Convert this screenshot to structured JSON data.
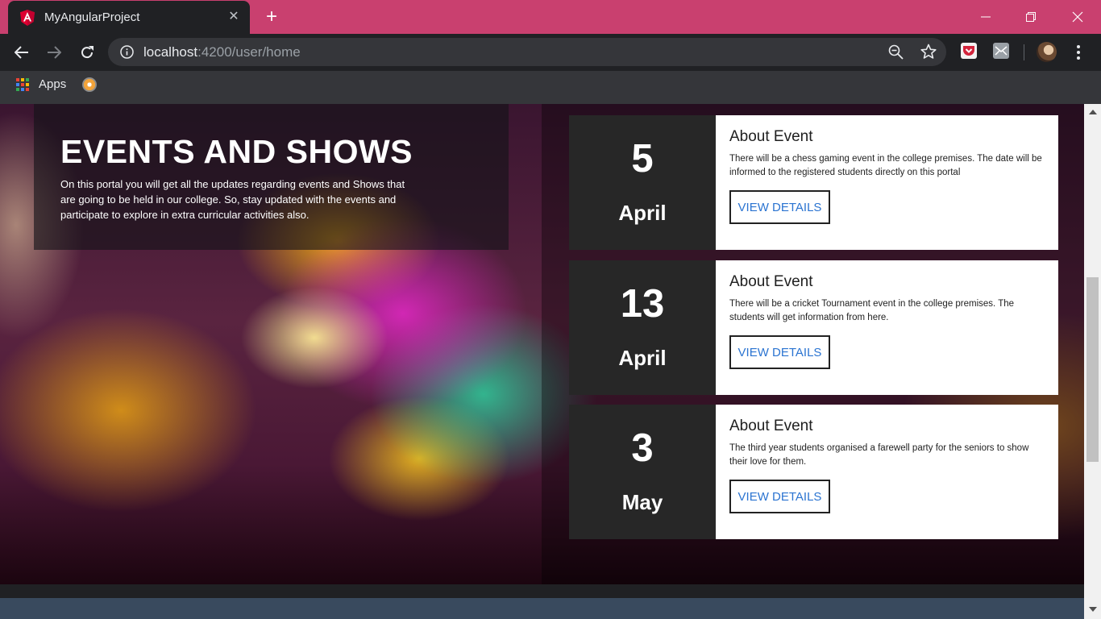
{
  "browser": {
    "tab_title": "MyAngularProject",
    "tab_close": "✕",
    "new_tab": "+",
    "url_host": "localhost",
    "url_path": ":4200/user/home",
    "bookmarks": [
      {
        "label": "Apps",
        "icon": "apps-grid-icon"
      },
      {
        "label": "",
        "icon": "bookmark-favicon-icon"
      }
    ],
    "accent_color": "#c9406f"
  },
  "hero": {
    "title": "EVENTS AND SHOWS",
    "description": "On this portal you will get all the updates regarding events and Shows that are going to be held in our college. So, stay updated with the events and participate to explore in extra curricular activities also."
  },
  "events": [
    {
      "day": "5",
      "month": "April",
      "title": "About Event",
      "description": "There will be a chess gaming event in the college premises. The date will be informed to the registered students directly on this portal",
      "button": "VIEW DETAILS"
    },
    {
      "day": "13",
      "month": "April",
      "title": "About Event",
      "description": "There will be a cricket Tournament event in the college premises. The students will get information from here.",
      "button": "VIEW DETAILS"
    },
    {
      "day": "3",
      "month": "May",
      "title": "About Event",
      "description": "The third year students organised a farewell party for the seniors to show their love for them.",
      "button": "VIEW DETAILS"
    }
  ]
}
